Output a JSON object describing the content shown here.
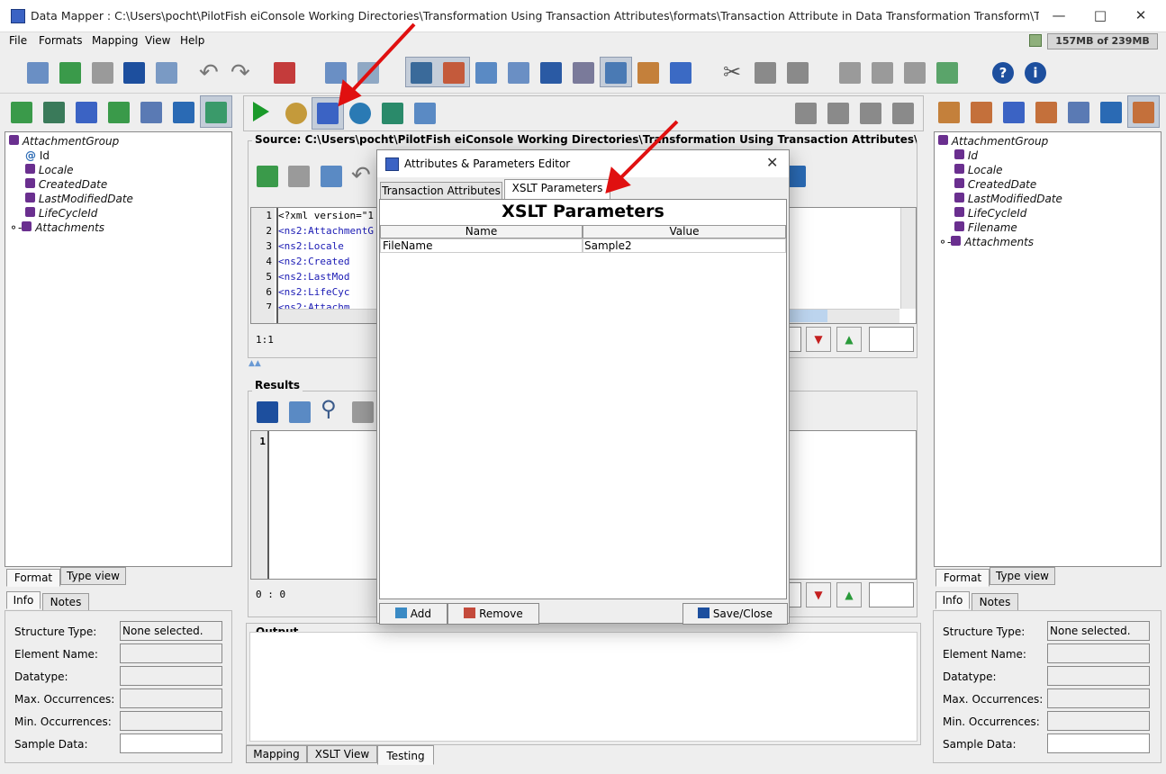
{
  "window": {
    "title": "Data Mapper : C:\\Users\\pocht\\PilotFish eiConsole Working Directories\\Transformation Using Transaction Attributes\\formats\\Transaction Attribute in Data Transformation Transform\\TransactionAttributeTransform..."
  },
  "menu": [
    "File",
    "Formats",
    "Mapping",
    "View",
    "Help"
  ],
  "memory": "157MB of 239MB",
  "source_panel": {
    "title": "Source: C:\\Users\\pocht\\PilotFish eiConsole Working Directories\\Transformation Using Transaction Attributes\\formats\\Transacti...",
    "lines": [
      {
        "n": "1",
        "text": "<?xml version=\"1"
      },
      {
        "n": "2",
        "text": "<ns2:AttachmentG"
      },
      {
        "n": "3",
        "text": "  <ns2:Locale"
      },
      {
        "n": "4",
        "text": "  <ns2:Created"
      },
      {
        "n": "5",
        "text": "  <ns2:LastMod"
      },
      {
        "n": "6",
        "text": "  <ns2:LifeCyc"
      },
      {
        "n": "7",
        "text": "  <ns2:Attachm"
      }
    ],
    "position": "1:1"
  },
  "results_panel": {
    "title": "Results",
    "line": "1",
    "position": "0 : 0"
  },
  "output_panel": {
    "title": "Output"
  },
  "bottom_tabs": [
    "Mapping",
    "XSLT View",
    "Testing"
  ],
  "left_tree": {
    "root": "AttachmentGroup",
    "items": [
      "Id",
      "Locale",
      "CreatedDate",
      "LastModifiedDate",
      "LifeCycleId",
      "Attachments"
    ]
  },
  "right_tree": {
    "root": "AttachmentGroup",
    "items": [
      "Id",
      "Locale",
      "CreatedDate",
      "LastModifiedDate",
      "LifeCycleId",
      "Filename",
      "Attachments"
    ]
  },
  "view_tabs": [
    "Format",
    "Type view"
  ],
  "info_tabs": [
    "Info",
    "Notes"
  ],
  "info_fields": [
    {
      "label": "Structure Type:",
      "value": "None selected."
    },
    {
      "label": "Element Name:",
      "value": ""
    },
    {
      "label": "Datatype:",
      "value": ""
    },
    {
      "label": "Max. Occurrences:",
      "value": ""
    },
    {
      "label": "Min. Occurrences:",
      "value": ""
    },
    {
      "label": "Sample Data:",
      "value": ""
    }
  ],
  "dialog": {
    "title": "Attributes & Parameters Editor",
    "tabs": [
      "Transaction Attributes",
      "XSLT Parameters"
    ],
    "heading": "XSLT Parameters",
    "columns": [
      "Name",
      "Value"
    ],
    "rows": [
      {
        "name": "FileName",
        "value": "Sample2"
      }
    ],
    "buttons": {
      "add": "Add",
      "remove": "Remove",
      "save": "Save/Close"
    }
  },
  "colors": {
    "accent": "#3b63c4",
    "annotation": "#e01010",
    "tree_icon": "#6a2f8f"
  }
}
